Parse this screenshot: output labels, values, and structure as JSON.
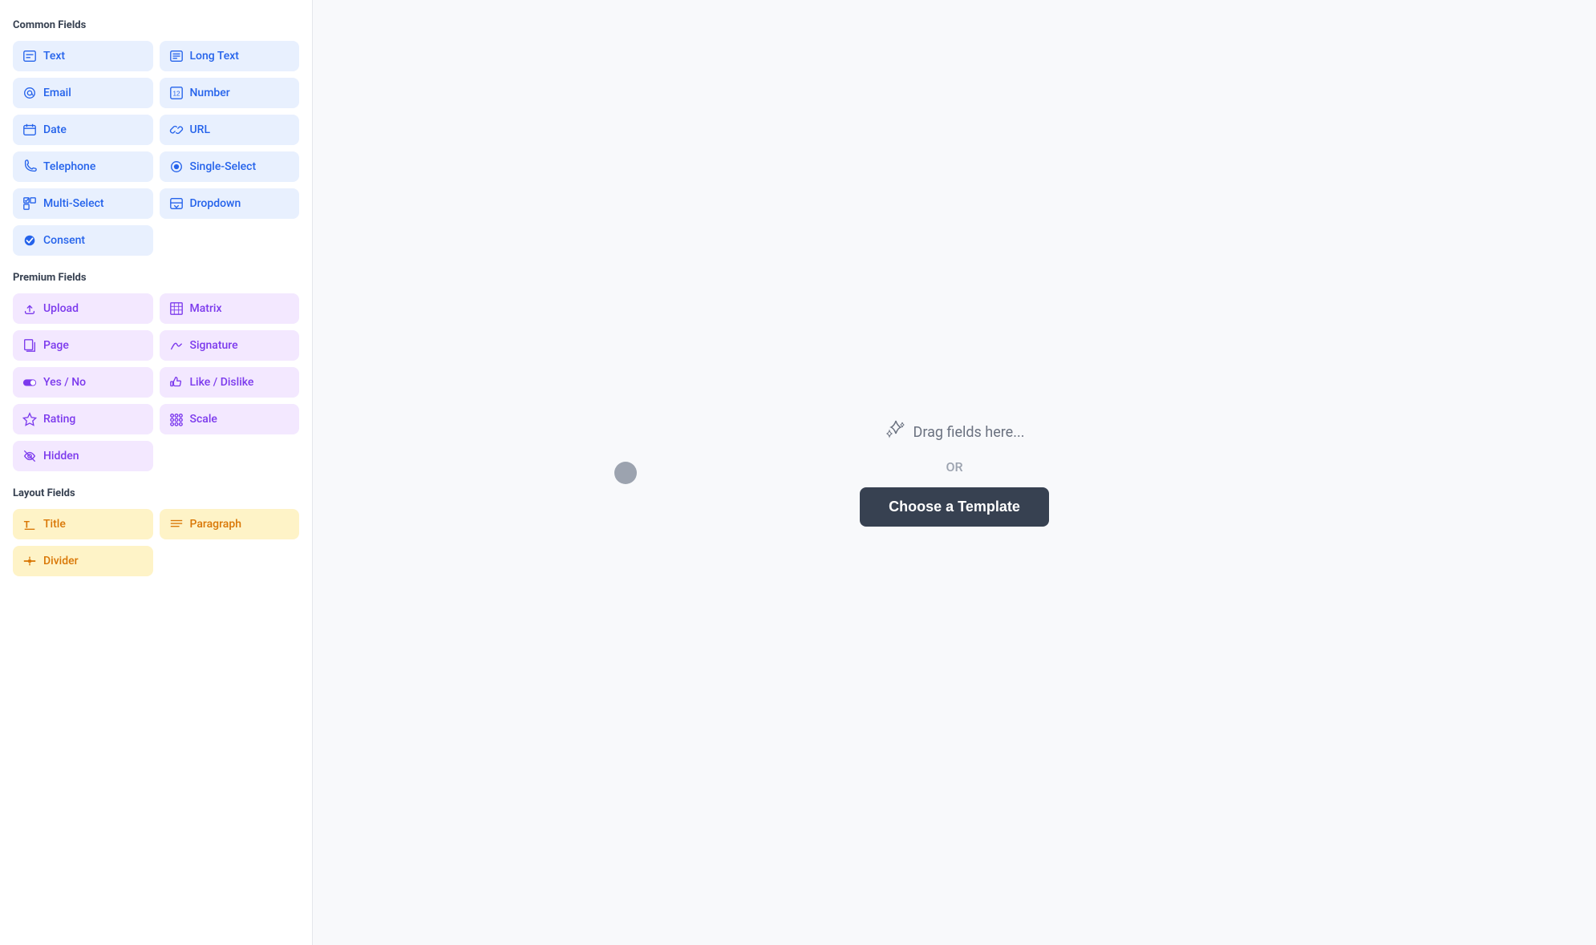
{
  "sidebar": {
    "common_section_title": "Common Fields",
    "premium_section_title": "Premium Fields",
    "layout_section_title": "Layout Fields",
    "common_fields": [
      {
        "id": "text",
        "label": "Text",
        "icon": "text-icon",
        "unicode": "⊡",
        "col": 1
      },
      {
        "id": "long-text",
        "label": "Long Text",
        "icon": "long-text-icon",
        "unicode": "⊟",
        "col": 2
      },
      {
        "id": "email",
        "label": "Email",
        "icon": "email-icon",
        "unicode": "@",
        "col": 1
      },
      {
        "id": "number",
        "label": "Number",
        "icon": "number-icon",
        "unicode": "⊞",
        "col": 2
      },
      {
        "id": "date",
        "label": "Date",
        "icon": "date-icon",
        "unicode": "⊡",
        "col": 1
      },
      {
        "id": "url",
        "label": "URL",
        "icon": "url-icon",
        "unicode": "⊘",
        "col": 2
      },
      {
        "id": "telephone",
        "label": "Telephone",
        "icon": "telephone-icon",
        "unicode": "☎",
        "col": 1
      },
      {
        "id": "single-select",
        "label": "Single-Select",
        "icon": "single-select-icon",
        "unicode": "◎",
        "col": 2
      },
      {
        "id": "multi-select",
        "label": "Multi-Select",
        "icon": "multi-select-icon",
        "unicode": "☑",
        "col": 1
      },
      {
        "id": "dropdown",
        "label": "Dropdown",
        "icon": "dropdown-icon",
        "unicode": "⊟",
        "col": 2
      },
      {
        "id": "consent",
        "label": "Consent",
        "icon": "consent-icon",
        "unicode": "✔",
        "col": "full"
      }
    ],
    "premium_fields": [
      {
        "id": "upload",
        "label": "Upload",
        "icon": "upload-icon",
        "unicode": "↑",
        "col": 1
      },
      {
        "id": "matrix",
        "label": "Matrix",
        "icon": "matrix-icon",
        "unicode": "⊞",
        "col": 2
      },
      {
        "id": "page",
        "label": "Page",
        "icon": "page-icon",
        "unicode": "⊡",
        "col": 1
      },
      {
        "id": "signature",
        "label": "Signature",
        "icon": "signature-icon",
        "unicode": "✍",
        "col": 2
      },
      {
        "id": "yes-no",
        "label": "Yes / No",
        "icon": "yes-no-icon",
        "unicode": "⊙",
        "col": 1
      },
      {
        "id": "like-dislike",
        "label": "Like / Dislike",
        "icon": "like-dislike-icon",
        "unicode": "👍",
        "col": 2
      },
      {
        "id": "rating",
        "label": "Rating",
        "icon": "rating-icon",
        "unicode": "☆",
        "col": 1
      },
      {
        "id": "scale",
        "label": "Scale",
        "icon": "scale-icon",
        "unicode": "⠿",
        "col": 2
      },
      {
        "id": "hidden",
        "label": "Hidden",
        "icon": "hidden-icon",
        "unicode": "◎",
        "col": "full"
      }
    ],
    "layout_fields": [
      {
        "id": "title",
        "label": "Title",
        "icon": "title-icon",
        "unicode": "T",
        "col": 1
      },
      {
        "id": "paragraph",
        "label": "Paragraph",
        "icon": "paragraph-icon",
        "unicode": "≡",
        "col": 2
      },
      {
        "id": "divider",
        "label": "Divider",
        "icon": "divider-icon",
        "unicode": "⊕",
        "col": "full"
      }
    ]
  },
  "main": {
    "drag_hint": "Drag fields here...",
    "or_text": "OR",
    "choose_template_label": "Choose a Template"
  }
}
